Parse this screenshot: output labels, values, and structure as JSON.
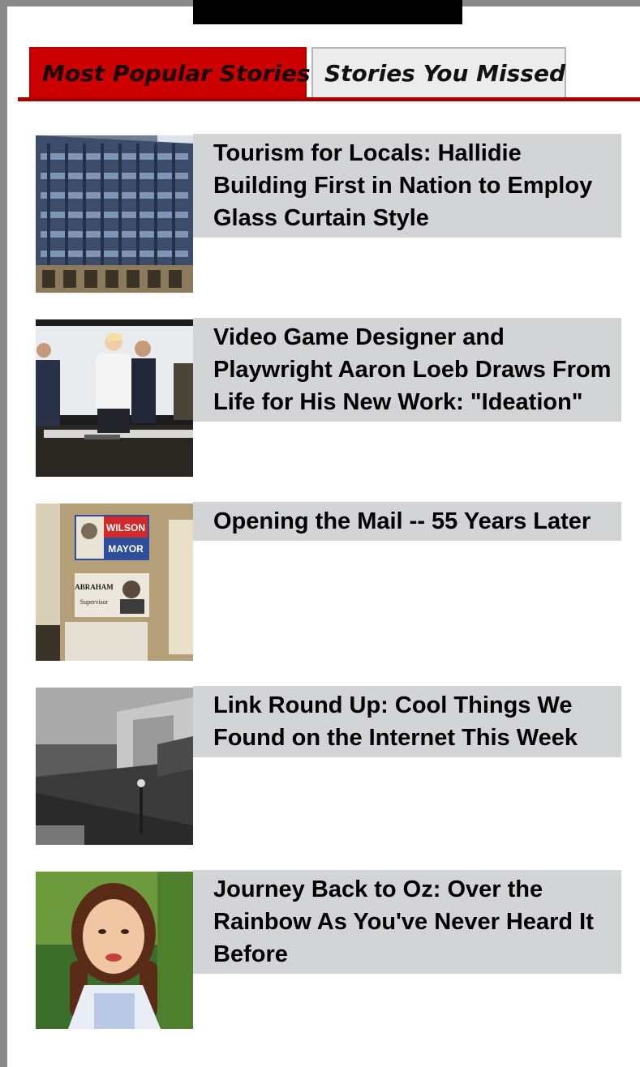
{
  "tabs": {
    "active_label": "Most Popular Stories",
    "inactive_label": "Stories You Missed"
  },
  "colors": {
    "accent_red": "#cc0000",
    "headline_bg": "#d2d4d6",
    "frame_gray": "#8a8a8a"
  },
  "stories": [
    {
      "title": "Tourism for Locals: Hallidie Building First in Nation to Employ Glass Curtain Style",
      "thumbnail": "glass-building-photo"
    },
    {
      "title": "Video Game Designer and Playwright Aaron Loeb Draws From Life for His New Work: \"Ideation\"",
      "thumbnail": "stage-actors-photo"
    },
    {
      "title": "Opening the Mail -- 55 Years Later",
      "thumbnail": "campaign-posters-photo",
      "poster_text": {
        "line1": "WILSON",
        "line2": "MAYOR",
        "line3": "ABRAHAM",
        "line4": "Supervisor"
      }
    },
    {
      "title": "Link Round Up: Cool Things We Found on the Internet This Week",
      "thumbnail": "black-white-street-photo"
    },
    {
      "title": "Journey Back to Oz: Over the Rainbow As You've Never Heard It Before",
      "thumbnail": "dorothy-portrait-photo"
    }
  ]
}
